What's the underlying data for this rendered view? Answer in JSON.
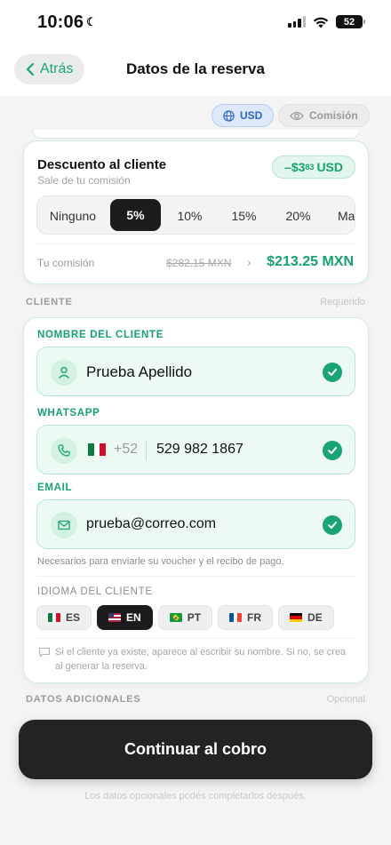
{
  "status_bar": {
    "time": "10:06",
    "battery": "52"
  },
  "nav": {
    "back_label": "Atrás",
    "title": "Datos de la reserva"
  },
  "currency_toggle": {
    "usd_label": "USD",
    "commission_label": "Comisión"
  },
  "discount": {
    "title": "Descuento al cliente",
    "subtitle": "Sale de tu comisión",
    "badge_main": "–$3",
    "badge_cents": "83",
    "badge_currency": "USD",
    "options": [
      "Ninguno",
      "5%",
      "10%",
      "15%",
      "20%",
      "Ma"
    ],
    "selected_option": "5%",
    "commission_label": "Tu comisión",
    "old_commission": "$282.15 MXN",
    "arrow": "›",
    "new_commission": "$213.25 MXN"
  },
  "client_section": {
    "label": "CLIENTE",
    "required": "Requerido"
  },
  "client": {
    "name_label": "NOMBRE DEL CLIENTE",
    "name_value": "Prueba Apellido",
    "whatsapp_label": "WHATSAPP",
    "country_code": "+52",
    "phone_value": "529 982 1867",
    "email_label": "EMAIL",
    "email_value": "prueba@correo.com",
    "hint": "Necesarios para enviarle su voucher y el recibo de pago.",
    "language_label": "IDIOMA DEL CLIENTE",
    "languages": [
      "ES",
      "EN",
      "PT",
      "FR",
      "DE"
    ],
    "selected_language": "EN",
    "note": "Si el cliente ya existe, aparece al escribir su nombre. Si no, se crea al generar la reserva."
  },
  "additional_section": {
    "label": "DATOS ADICIONALES",
    "optional": "Opcional"
  },
  "continue_button": "Continuar al cobro",
  "footer_hint": "Los datos opcionales podés completarlos después.",
  "colors": {
    "accent": "#16a36e",
    "dark": "#1c1c1e",
    "blue": "#2c64c8"
  }
}
